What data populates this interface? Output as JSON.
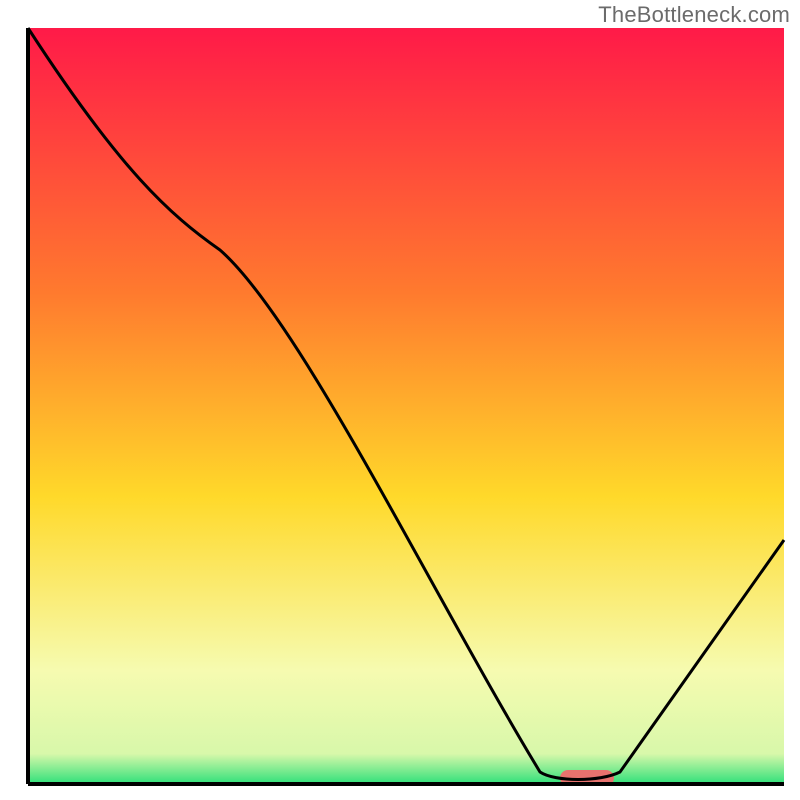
{
  "watermark": "TheBottleneck.com",
  "chart_data": {
    "type": "line",
    "title": "",
    "xlabel": "",
    "ylabel": "",
    "xlim": [
      0,
      100
    ],
    "ylim": [
      0,
      100
    ],
    "x": [
      0,
      25,
      70,
      78,
      100
    ],
    "values": [
      100,
      75,
      1,
      1,
      32
    ],
    "series": [
      {
        "name": "curve",
        "x": [
          0,
          25,
          70,
          78,
          100
        ],
        "values": [
          100,
          75,
          1,
          1,
          32
        ]
      }
    ],
    "marker": {
      "x": 74,
      "y": 0,
      "width": 6,
      "color": "#e8726e"
    },
    "background_gradient": {
      "top": "#ff1a48",
      "mid1": "#ff8a2a",
      "mid2": "#ffde2a",
      "mid3": "#f7fca0",
      "bottom": "#2fe07a"
    },
    "axis_color": "#000000",
    "line_color": "#000000",
    "line_width": 3
  }
}
